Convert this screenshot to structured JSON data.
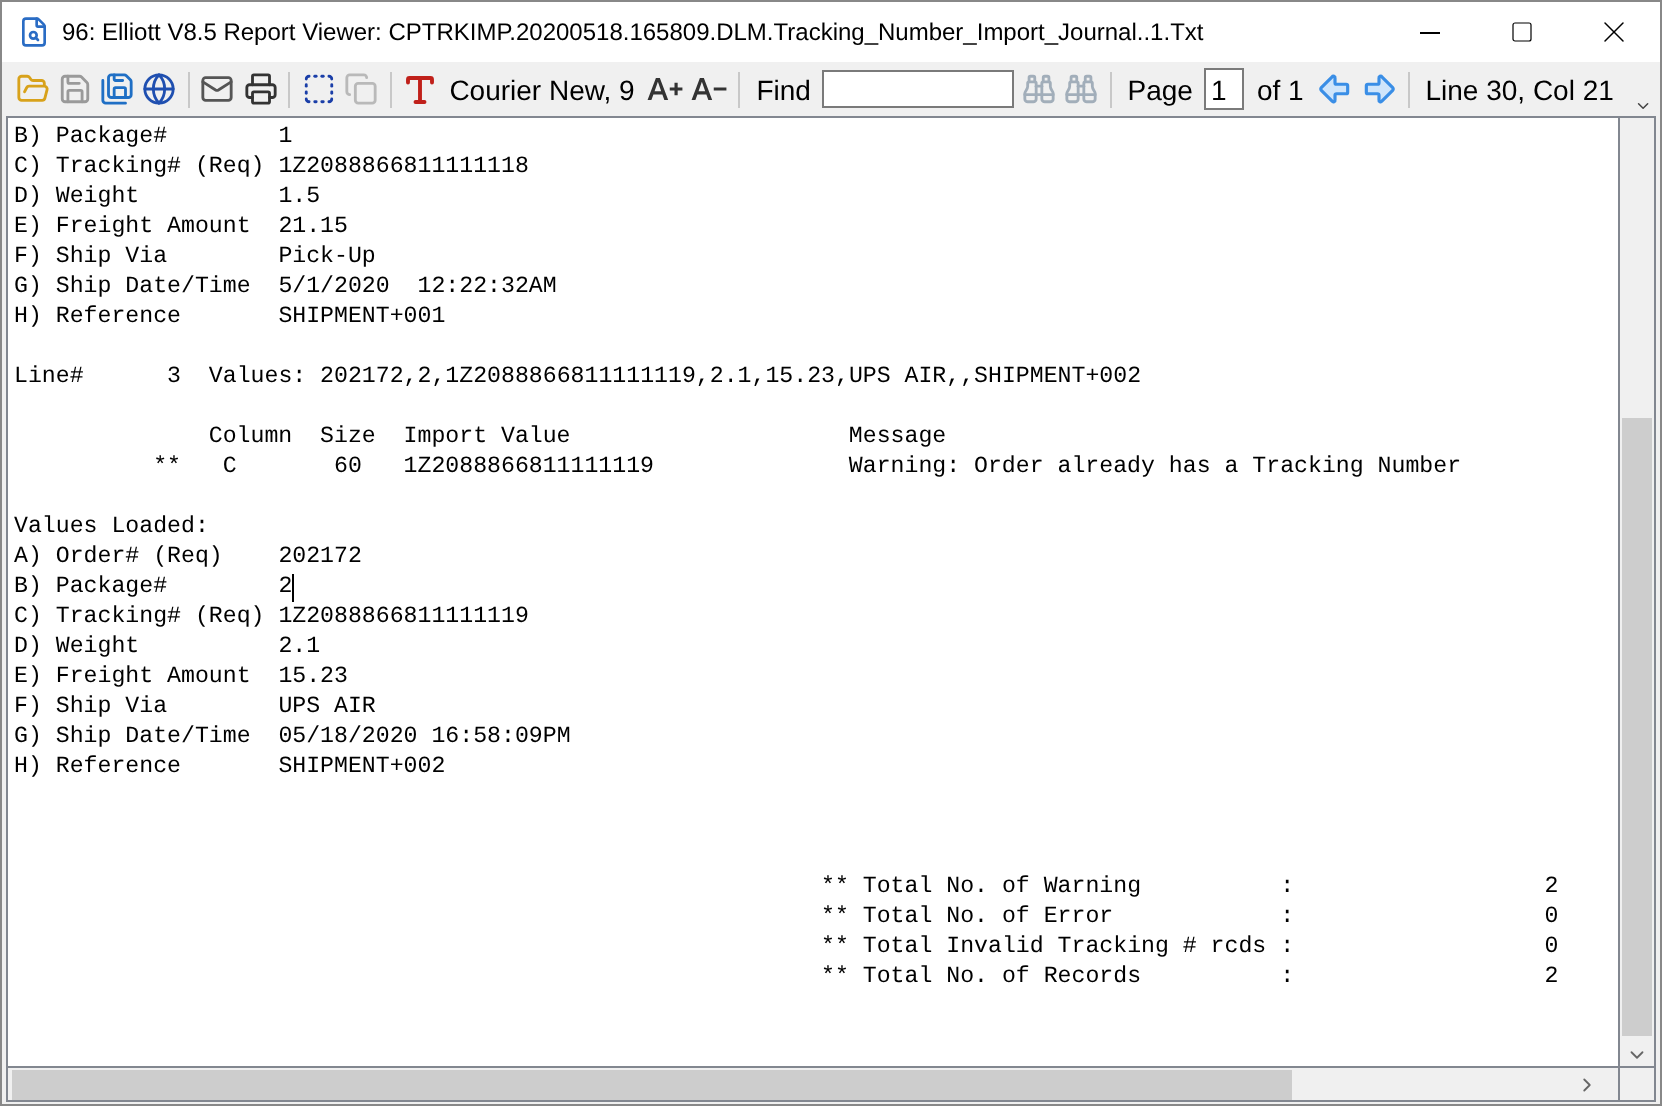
{
  "window": {
    "title": "96: Elliott V8.5 Report Viewer: CPTRKIMP.20200518.165809.DLM.Tracking_Number_Import_Journal..1.Txt"
  },
  "toolbar": {
    "font": "Courier New, 9",
    "find_label": "Find",
    "page_label": "Page",
    "page": "1",
    "page_total": "of 1",
    "position": "Line 30, Col 21",
    "buttons": [
      {
        "kind": "open",
        "disabled": false
      },
      {
        "kind": "save",
        "disabled": true
      },
      {
        "kind": "save-as",
        "disabled": false
      },
      {
        "kind": "web",
        "disabled": false
      },
      {
        "kind": "sep"
      },
      {
        "kind": "mail",
        "disabled": false
      },
      {
        "kind": "print",
        "disabled": false
      },
      {
        "kind": "sep"
      },
      {
        "kind": "select",
        "disabled": false
      },
      {
        "kind": "copy",
        "disabled": true
      },
      {
        "kind": "sep"
      }
    ]
  },
  "report": [
    {
      "kind": "field",
      "label": "B) Package#",
      "value": "1"
    },
    {
      "kind": "field",
      "label": "C) Tracking# (Req)",
      "value": "1Z2088866811111118"
    },
    {
      "kind": "field",
      "label": "D) Weight",
      "value": "1.5"
    },
    {
      "kind": "field",
      "label": "E) Freight Amount",
      "value": "21.15"
    },
    {
      "kind": "field",
      "label": "F) Ship Via",
      "value": "Pick-Up"
    },
    {
      "kind": "field",
      "label": "G) Ship Date/Time",
      "value": "5/1/2020  12:22:32AM"
    },
    {
      "kind": "field",
      "label": "H) Reference",
      "value": "SHIPMENT+001"
    },
    {
      "kind": "blank"
    },
    {
      "kind": "text",
      "text": "Line#      3  Values: 202172,2,1Z2088866811111119,2.1,15.23,UPS AIR,,SHIPMENT+002"
    },
    {
      "kind": "blank"
    },
    {
      "kind": "columns",
      "cells": [
        "Column",
        "Size",
        "Import Value",
        "Message"
      ]
    },
    {
      "kind": "issue",
      "cells": [
        "**",
        "C",
        "60",
        "1Z2088866811111119",
        "Warning: Order already has a Tracking Number"
      ]
    },
    {
      "kind": "blank"
    },
    {
      "kind": "text",
      "text": "Values Loaded:"
    },
    {
      "kind": "field",
      "label": "A) Order# (Req)",
      "value": "202172"
    },
    {
      "kind": "field",
      "label": "B) Package#",
      "value": "2",
      "cursor": true
    },
    {
      "kind": "field",
      "label": "C) Tracking# (Req)",
      "value": "1Z2088866811111119"
    },
    {
      "kind": "field",
      "label": "D) Weight",
      "value": "2.1"
    },
    {
      "kind": "field",
      "label": "E) Freight Amount",
      "value": "15.23"
    },
    {
      "kind": "field",
      "label": "F) Ship Via",
      "value": "UPS AIR"
    },
    {
      "kind": "field",
      "label": "G) Ship Date/Time",
      "value": "05/18/2020 16:58:09PM"
    },
    {
      "kind": "field",
      "label": "H) Reference",
      "value": "SHIPMENT+002"
    },
    {
      "kind": "blank"
    },
    {
      "kind": "blank"
    },
    {
      "kind": "blank"
    },
    {
      "kind": "total",
      "mark": "**",
      "label": "Total No. of Warning",
      "colon": ":",
      "value": "2"
    },
    {
      "kind": "total",
      "mark": "**",
      "label": "Total No. of Error",
      "colon": ":",
      "value": "0"
    },
    {
      "kind": "total",
      "mark": "**",
      "label": "Total Invalid Tracking # rcds",
      "colon": ":",
      "value": "0"
    },
    {
      "kind": "total",
      "mark": "**",
      "label": "Total No. of Records",
      "colon": ":",
      "value": "2"
    }
  ]
}
